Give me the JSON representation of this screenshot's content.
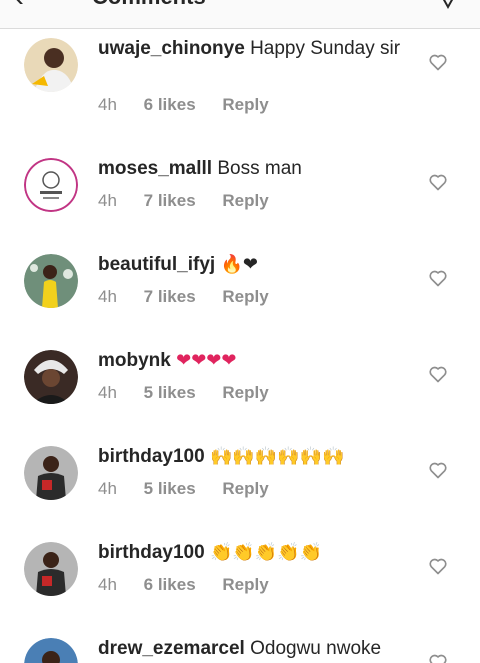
{
  "header": {
    "title": "Comments"
  },
  "comments": [
    {
      "username": "uwaje_chinonye",
      "text": "Happy Sunday sir",
      "emoji": "",
      "time": "4h",
      "likes": "6 likes",
      "reply": "Reply",
      "avatar_color": "#d8c7a8"
    },
    {
      "username": "moses_malll",
      "text": "Boss man",
      "emoji": "",
      "time": "4h",
      "likes": "7 likes",
      "reply": "Reply",
      "avatar_color": "#ffffff"
    },
    {
      "username": "beautiful_ifyj",
      "text": "",
      "emoji": "🔥❤",
      "time": "4h",
      "likes": "7 likes",
      "reply": "Reply",
      "avatar_color": "#6f8f7a"
    },
    {
      "username": "mobynk",
      "text": "",
      "emoji": "❤❤❤❤",
      "time": "4h",
      "likes": "5 likes",
      "reply": "Reply",
      "avatar_color": "#3a2a25"
    },
    {
      "username": "birthday100",
      "text": "",
      "emoji": "🙌🙌🙌🙌🙌🙌",
      "time": "4h",
      "likes": "5 likes",
      "reply": "Reply",
      "avatar_color": "#9a9a9a"
    },
    {
      "username": "birthday100",
      "text": "",
      "emoji": "👏👏👏👏👏",
      "time": "4h",
      "likes": "6 likes",
      "reply": "Reply",
      "avatar_color": "#9a9a9a"
    },
    {
      "username": "drew_ezemarcel",
      "text": "Odogwu nwoke",
      "emoji": "",
      "time": "",
      "likes": "",
      "reply": "",
      "avatar_color": "#4a7fb5"
    }
  ]
}
